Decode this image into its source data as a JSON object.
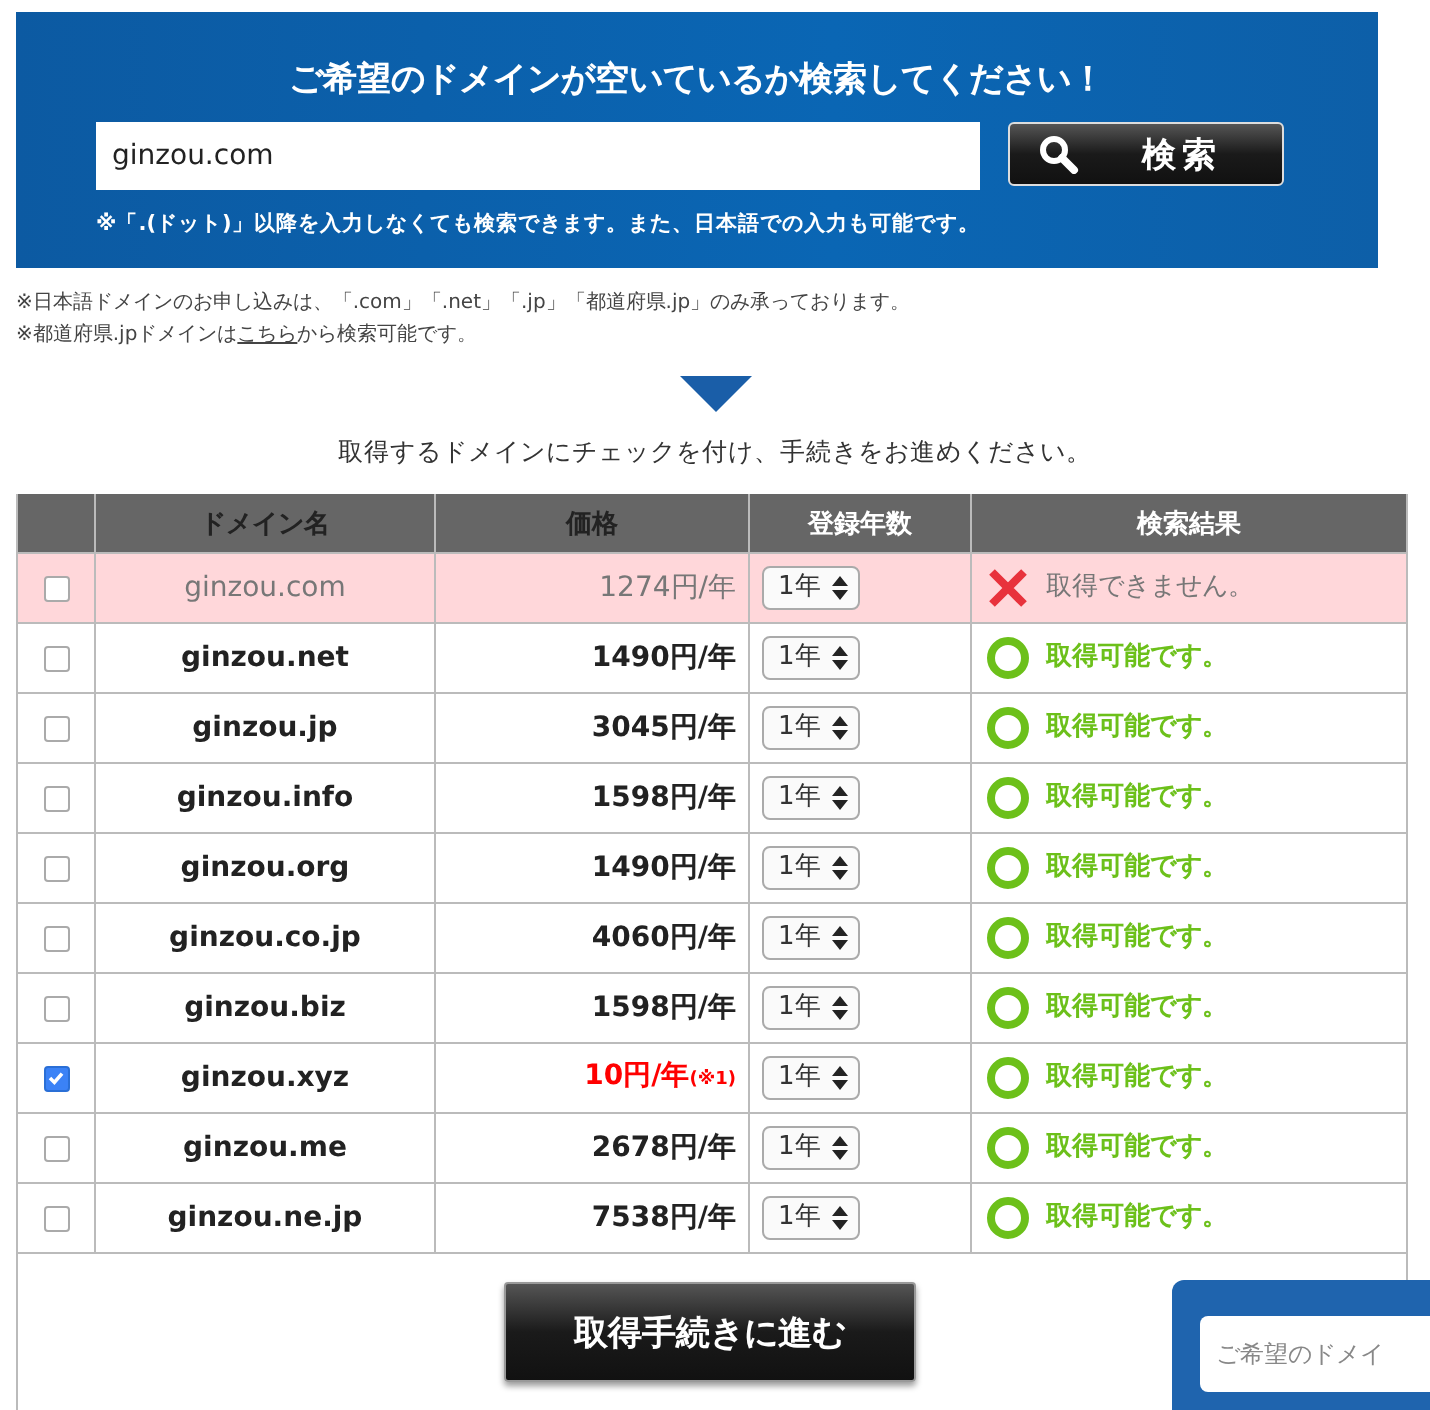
{
  "search": {
    "title": "ご希望のドメインが空いているか検索してください！",
    "value": "ginzou.com",
    "button": "検索",
    "hint": "※「.(ドット)」以降を入力しなくても検索できます。また、日本語での入力も可能です。"
  },
  "notes": [
    {
      "before": "※日本語ドメインのお申し込みは、「.com」「.net」「.jp」「都道府県.jp」のみ承っております。"
    },
    {
      "before": "※都道府県.jpドメインは",
      "link": "こちら",
      "after": "から検索可能です。"
    }
  ],
  "instruction": "取得するドメインにチェックを付け、手続きをお進めください。",
  "table": {
    "columns": [
      "ドメイン名",
      "価格",
      "登録年数",
      "検索結果"
    ],
    "rows": [
      {
        "domain": "ginzou.com",
        "price": "1274円/年",
        "years": "1年",
        "kind": "unavailable",
        "result": "取得できません。",
        "checked": false
      },
      {
        "domain": "ginzou.net",
        "price": "1490円/年",
        "years": "1年",
        "kind": "available",
        "result": "取得可能です。",
        "checked": false
      },
      {
        "domain": "ginzou.jp",
        "price": "3045円/年",
        "years": "1年",
        "kind": "available",
        "result": "取得可能です。",
        "checked": false
      },
      {
        "domain": "ginzou.info",
        "price": "1598円/年",
        "years": "1年",
        "kind": "available",
        "result": "取得可能です。",
        "checked": false
      },
      {
        "domain": "ginzou.org",
        "price": "1490円/年",
        "years": "1年",
        "kind": "available",
        "result": "取得可能です。",
        "checked": false
      },
      {
        "domain": "ginzou.co.jp",
        "price": "4060円/年",
        "years": "1年",
        "kind": "available",
        "result": "取得可能です。",
        "checked": false
      },
      {
        "domain": "ginzou.biz",
        "price": "1598円/年",
        "years": "1年",
        "kind": "available",
        "result": "取得可能です。",
        "checked": false
      },
      {
        "domain": "ginzou.xyz",
        "price": "10円/年",
        "price_note": "(※1)",
        "price_highlight": true,
        "years": "1年",
        "kind": "available",
        "result": "取得可能です。",
        "checked": true
      },
      {
        "domain": "ginzou.me",
        "price": "2678円/年",
        "years": "1年",
        "kind": "available",
        "result": "取得可能です。",
        "checked": false
      },
      {
        "domain": "ginzou.ne.jp",
        "price": "7538円/年",
        "years": "1年",
        "kind": "available",
        "result": "取得可能です。",
        "checked": false
      }
    ]
  },
  "proceed_button": "取得手続きに進む",
  "floating_search": {
    "placeholder": "ご希望のドメイ"
  }
}
